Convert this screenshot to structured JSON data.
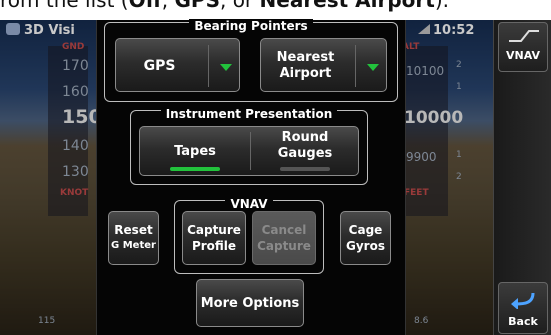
{
  "banner": {
    "prefix": "rom the list (",
    "opt1": "Off",
    "sep1": ", ",
    "opt2": "GPS",
    "sep2": ", or ",
    "opt3": "Nearest Airport",
    "suffix": ")."
  },
  "background": {
    "app_title": "3D Visi",
    "clock": "10:52",
    "speed_ticks": [
      "170",
      "160",
      "150",
      "140",
      "130"
    ],
    "altitude_ticks": [
      "10100",
      "10000",
      "9900"
    ],
    "small_ticks": [
      "2",
      "1",
      "1",
      "2"
    ],
    "bottom_left": "115",
    "bottom_right": "8.6",
    "red_labels": [
      "GND",
      "KNOT",
      "ALT",
      "FEET"
    ]
  },
  "sidebar": {
    "vnav_label": "VNAV",
    "back_label": "Back"
  },
  "bearing_pointers": {
    "title": "Bearing Pointers",
    "pointer1": "GPS",
    "pointer2_line1": "Nearest",
    "pointer2_line2": "Airport"
  },
  "instrument_presentation": {
    "title": "Instrument Presentation",
    "tapes_label": "Tapes",
    "round_gauges_line1": "Round",
    "round_gauges_line2": "Gauges",
    "selected": "Tapes"
  },
  "vnav": {
    "title": "VNAV",
    "capture_line1": "Capture",
    "capture_line2": "Profile",
    "cancel_line1": "Cancel",
    "cancel_line2": "Capture"
  },
  "buttons": {
    "reset_line1": "Reset",
    "reset_line2": "G Meter",
    "cage_line1": "Cage",
    "cage_line2": "Gyros",
    "more_options": "More Options"
  },
  "colors": {
    "active_indicator": "#22c23c",
    "inactive_indicator": "#555555",
    "dropdown_arrow": "#22c23c"
  }
}
